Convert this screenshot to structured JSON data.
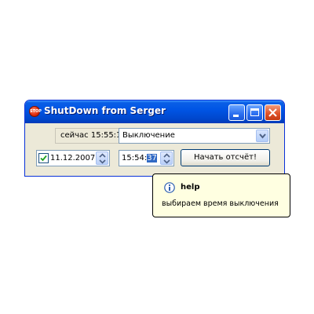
{
  "window": {
    "title": "ShutDown from Serger",
    "icon": "stop-sign-icon"
  },
  "status": {
    "now_text": "сейчас 15:55:1"
  },
  "action_select": {
    "selected": "Выключение"
  },
  "date_picker": {
    "checked": true,
    "value": "11.12.2007"
  },
  "time_picker": {
    "prefix": "15:54:",
    "selected_part": "37"
  },
  "start_button": {
    "label": "Начать отсчёт!"
  },
  "tooltip": {
    "title": "help",
    "text": "выбираем время выключения",
    "icon": "info-icon"
  }
}
